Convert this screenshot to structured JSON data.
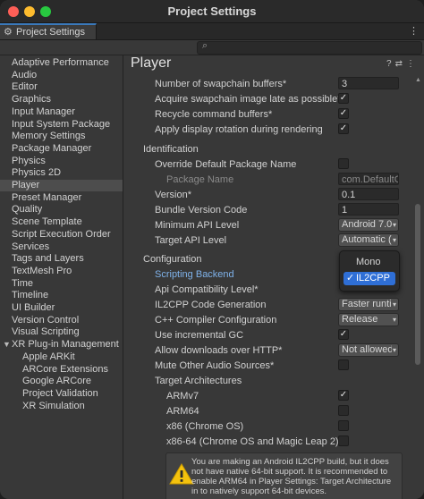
{
  "window": {
    "title": "Project Settings"
  },
  "tab": {
    "label": "Project Settings",
    "icon": "gear-icon"
  },
  "sidebar": {
    "items": [
      {
        "label": "Adaptive Performance",
        "selected": false
      },
      {
        "label": "Audio",
        "selected": false
      },
      {
        "label": "Editor",
        "selected": false
      },
      {
        "label": "Graphics",
        "selected": false
      },
      {
        "label": "Input Manager",
        "selected": false
      },
      {
        "label": "Input System Package",
        "selected": false
      },
      {
        "label": "Memory Settings",
        "selected": false
      },
      {
        "label": "Package Manager",
        "selected": false
      },
      {
        "label": "Physics",
        "selected": false
      },
      {
        "label": "Physics 2D",
        "selected": false
      },
      {
        "label": "Player",
        "selected": true
      },
      {
        "label": "Preset Manager",
        "selected": false
      },
      {
        "label": "Quality",
        "selected": false
      },
      {
        "label": "Scene Template",
        "selected": false
      },
      {
        "label": "Script Execution Order",
        "selected": false
      },
      {
        "label": "Services",
        "selected": false
      },
      {
        "label": "Tags and Layers",
        "selected": false
      },
      {
        "label": "TextMesh Pro",
        "selected": false
      },
      {
        "label": "Time",
        "selected": false
      },
      {
        "label": "Timeline",
        "selected": false
      },
      {
        "label": "UI Builder",
        "selected": false
      },
      {
        "label": "Version Control",
        "selected": false
      },
      {
        "label": "Visual Scripting",
        "selected": false
      },
      {
        "label": "XR Plug-in Management",
        "selected": false
      },
      {
        "label": "Apple ARKit",
        "selected": false
      },
      {
        "label": "ARCore Extensions",
        "selected": false
      },
      {
        "label": "Google ARCore",
        "selected": false
      },
      {
        "label": "Project Validation",
        "selected": false
      },
      {
        "label": "XR Simulation",
        "selected": false
      }
    ]
  },
  "main": {
    "heading": "Player",
    "rows": {
      "swapchain_label": "Number of swapchain buffers*",
      "swapchain_value": "3",
      "acquire_label": "Acquire swapchain image late as possible*",
      "recycle_label": "Recycle command buffers*",
      "display_rotation_label": "Apply display rotation during rendering",
      "identification_section": "Identification",
      "override_pkg_label": "Override Default Package Name",
      "package_name_label": "Package Name",
      "package_name_value": "com.DefaultC",
      "version_label": "Version*",
      "version_value": "0.1",
      "bundle_label": "Bundle Version Code",
      "bundle_value": "1",
      "min_api_label": "Minimum API Level",
      "min_api_value": "Android 7.0",
      "target_api_label": "Target API Level",
      "target_api_value": "Automatic (",
      "configuration_section": "Configuration",
      "scripting_backend_label": "Scripting Backend",
      "api_compat_label": "Api Compatibility Level*",
      "il2cpp_gen_label": "IL2CPP Code Generation",
      "il2cpp_gen_value": "Faster runti",
      "cpp_compiler_label": "C++ Compiler Configuration",
      "cpp_compiler_value": "Release",
      "incremental_gc_label": "Use incremental GC",
      "downloads_http_label": "Allow downloads over HTTP*",
      "downloads_http_value": "Not allowed",
      "mute_audio_label": "Mute Other Audio Sources*",
      "target_arch_label": "Target Architectures",
      "armv7_label": "ARMv7",
      "arm64_label": "ARM64",
      "x86_label": "x86 (Chrome OS)",
      "x86_64_label": "x86-64 (Chrome OS and Magic Leap 2)"
    },
    "checkboxes": {
      "acquire": true,
      "recycle": true,
      "display_rotation": true,
      "override_pkg": false,
      "incremental_gc": true,
      "mute_audio": false,
      "armv7": true,
      "arm64": false,
      "x86": false,
      "x86_64": false
    },
    "popup": {
      "option_mono": "Mono",
      "option_il2cpp": "IL2CPP",
      "checkmark": "✓"
    },
    "warning": {
      "text": "You are making an Android IL2CPP build, but it does not have native 64-bit support. It is recommended to enable ARM64 in Player Settings: Target Architecture in to natively support 64-bit devices."
    }
  },
  "colors": {
    "accent": "#2f6fd6",
    "link": "#7fb2ea",
    "panel": "#383838",
    "warning_icon": "#f4c20d"
  }
}
